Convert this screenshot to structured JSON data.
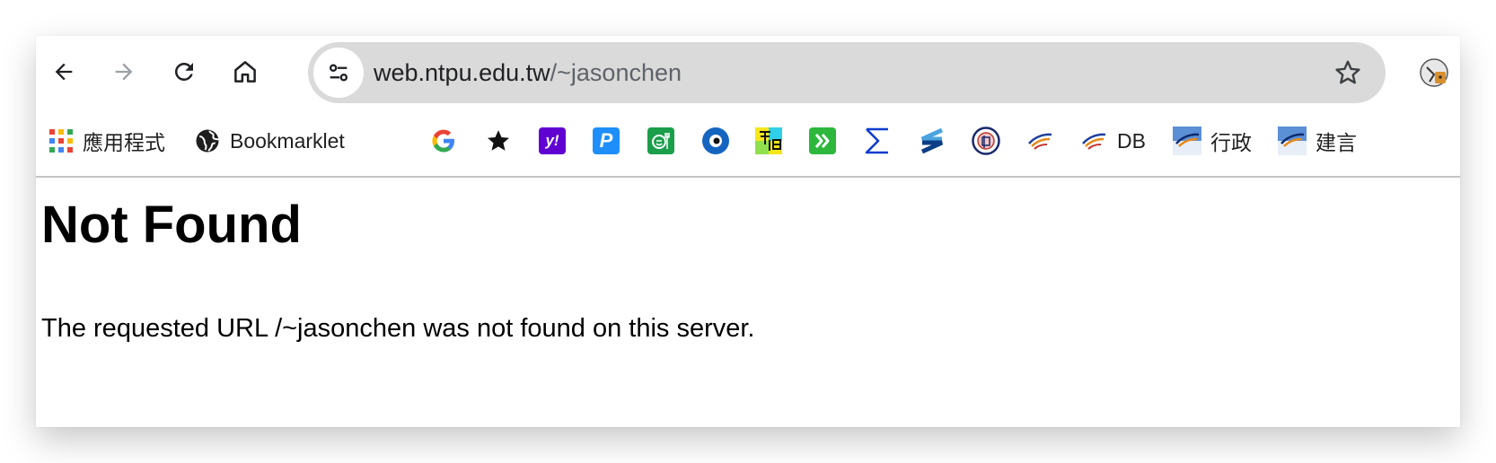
{
  "browser": {
    "address_bar": {
      "url_host": "web.ntpu.edu.tw",
      "url_path": "/~jasonchen"
    },
    "icons": {
      "back": "arrow-left-icon",
      "forward": "arrow-right-icon",
      "reload": "reload-icon",
      "home": "home-icon",
      "site_info": "tune-icon",
      "bookmark_star": "star-outline-icon",
      "profile": "profile-avatar-icon"
    }
  },
  "bookmarks": {
    "apps_label": "應用程式",
    "bookmarklet_label": "Bookmarklet",
    "db_label": "DB",
    "admin_label": "行政",
    "suggest_label": "建言",
    "icons": [
      "google-icon",
      "star-icon",
      "yahoo-icon",
      "p-icon",
      "eat-icon",
      "eye-icon",
      "dictionary-icon",
      "double-chevron-icon",
      "sigma-icon",
      "s-logo-icon",
      "seal-icon",
      "bird-logo-icon"
    ]
  },
  "page": {
    "heading": "Not Found",
    "message": "The requested URL /~jasonchen was not found on this server."
  },
  "colors": {
    "omnibox_bg": "#dadada",
    "google_blue": "#4285f4",
    "yahoo_purple": "#6001d2",
    "p_blue": "#1e8ffa",
    "green": "#1a9e4a",
    "bright_green": "#2db83d",
    "eye_blue": "#1565c0",
    "sigma_blue": "#0d3ccf",
    "s_blue": "#1565c0",
    "seal_navy": "#1a2a6c",
    "bird_orange": "#e78b1a"
  }
}
